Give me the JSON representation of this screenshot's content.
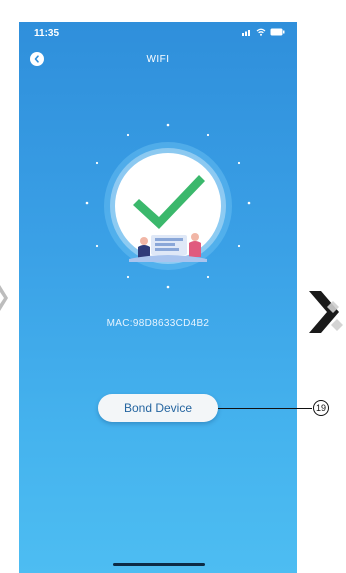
{
  "status_bar": {
    "time": "11:35",
    "icons": [
      "signal-icon",
      "wifi-icon",
      "battery-icon"
    ]
  },
  "nav": {
    "back_icon": "chevron-left-icon",
    "title": "WIFI"
  },
  "success_graphic": {
    "icon": "checkmark-icon",
    "accent_color": "#3bb86c"
  },
  "device": {
    "mac": "MAC:98D8633CD4B2"
  },
  "bond_button": {
    "label": "Bond Device"
  },
  "callout": {
    "number": "19"
  },
  "colors": {
    "background_top": "#2f8fdb",
    "background_bottom": "#4dbdf2",
    "button_text": "#2565a0"
  }
}
